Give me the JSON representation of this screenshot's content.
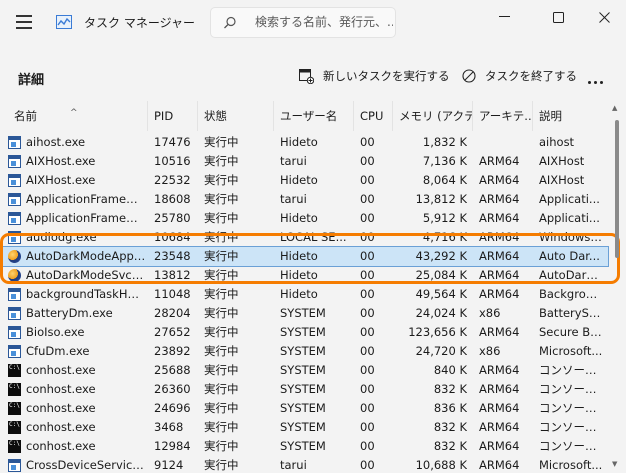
{
  "titlebar": {
    "title": "タスク マネージャー",
    "search_placeholder": "検索する名前、発行元、..."
  },
  "commandbar": {
    "page_title": "詳細",
    "new_task_label": "新しいタスクを実行する",
    "end_task_label": "タスクを終了する"
  },
  "columns": {
    "name": "名前",
    "pid": "PID",
    "status": "状態",
    "user": "ユーザー名",
    "cpu": "CPU",
    "memory": "メモリ (アクティ...",
    "arch": "アーキテ...",
    "desc": "説明"
  },
  "rows": [
    {
      "icon": "win",
      "name": "aihost.exe",
      "pid": "17476",
      "status": "実行中",
      "user": "Hideto",
      "cpu": "00",
      "memory": "1,832 K",
      "arch": "",
      "desc": "aihost"
    },
    {
      "icon": "win",
      "name": "AIXHost.exe",
      "pid": "10516",
      "status": "実行中",
      "user": "tarui",
      "cpu": "00",
      "memory": "7,136 K",
      "arch": "ARM64",
      "desc": "AIXHost"
    },
    {
      "icon": "win",
      "name": "AIXHost.exe",
      "pid": "22532",
      "status": "実行中",
      "user": "Hideto",
      "cpu": "00",
      "memory": "8,064 K",
      "arch": "ARM64",
      "desc": "AIXHost"
    },
    {
      "icon": "win",
      "name": "ApplicationFrameHo...",
      "pid": "18608",
      "status": "実行中",
      "user": "tarui",
      "cpu": "00",
      "memory": "13,812 K",
      "arch": "ARM64",
      "desc": "Applicati..."
    },
    {
      "icon": "win",
      "name": "ApplicationFrameHo...",
      "pid": "25780",
      "status": "実行中",
      "user": "Hideto",
      "cpu": "00",
      "memory": "5,912 K",
      "arch": "ARM64",
      "desc": "Applicati..."
    },
    {
      "icon": "win",
      "name": "audiodg.exe",
      "pid": "10684",
      "status": "実行中",
      "user": "LOCAL SE...",
      "cpu": "00",
      "memory": "4,716 K",
      "arch": "ARM64",
      "desc": "Windows ..."
    },
    {
      "icon": "auto",
      "name": "AutoDarkModeApp....",
      "pid": "23548",
      "status": "実行中",
      "user": "Hideto",
      "cpu": "00",
      "memory": "43,292 K",
      "arch": "ARM64",
      "desc": "Auto Dar..."
    },
    {
      "icon": "auto",
      "name": "AutoDarkModeSvc.e...",
      "pid": "13812",
      "status": "実行中",
      "user": "Hideto",
      "cpu": "00",
      "memory": "25,084 K",
      "arch": "ARM64",
      "desc": "AutoDark..."
    },
    {
      "icon": "win",
      "name": "backgroundTaskHos...",
      "pid": "11048",
      "status": "実行中",
      "user": "Hideto",
      "cpu": "00",
      "memory": "49,564 K",
      "arch": "ARM64",
      "desc": "Backgrou..."
    },
    {
      "icon": "win",
      "name": "BatteryDm.exe",
      "pid": "28204",
      "status": "実行中",
      "user": "SYSTEM",
      "cpu": "00",
      "memory": "24,024 K",
      "arch": "x86",
      "desc": "BatterySe..."
    },
    {
      "icon": "win",
      "name": "BioIso.exe",
      "pid": "27652",
      "status": "実行中",
      "user": "SYSTEM",
      "cpu": "00",
      "memory": "123,656 K",
      "arch": "ARM64",
      "desc": "Secure Bi..."
    },
    {
      "icon": "win",
      "name": "CfuDm.exe",
      "pid": "23892",
      "status": "実行中",
      "user": "SYSTEM",
      "cpu": "00",
      "memory": "24,720 K",
      "arch": "x86",
      "desc": "Microsoft..."
    },
    {
      "icon": "con",
      "name": "conhost.exe",
      "pid": "25688",
      "status": "実行中",
      "user": "SYSTEM",
      "cpu": "00",
      "memory": "840 K",
      "arch": "ARM64",
      "desc": "コンソール ..."
    },
    {
      "icon": "con",
      "name": "conhost.exe",
      "pid": "26360",
      "status": "実行中",
      "user": "SYSTEM",
      "cpu": "00",
      "memory": "832 K",
      "arch": "ARM64",
      "desc": "コンソール ..."
    },
    {
      "icon": "con",
      "name": "conhost.exe",
      "pid": "24696",
      "status": "実行中",
      "user": "SYSTEM",
      "cpu": "00",
      "memory": "836 K",
      "arch": "ARM64",
      "desc": "コンソール ..."
    },
    {
      "icon": "con",
      "name": "conhost.exe",
      "pid": "3468",
      "status": "実行中",
      "user": "SYSTEM",
      "cpu": "00",
      "memory": "832 K",
      "arch": "ARM64",
      "desc": "コンソール ..."
    },
    {
      "icon": "con",
      "name": "conhost.exe",
      "pid": "12984",
      "status": "実行中",
      "user": "SYSTEM",
      "cpu": "00",
      "memory": "832 K",
      "arch": "ARM64",
      "desc": "コンソール ..."
    },
    {
      "icon": "win",
      "name": "CrossDeviceService.e...",
      "pid": "9124",
      "status": "実行中",
      "user": "tarui",
      "cpu": "00",
      "memory": "10,688 K",
      "arch": "ARM64",
      "desc": "Microsoft..."
    }
  ],
  "selected_row": 6,
  "colors": {
    "highlight": "#f57c00",
    "selection": "#cce4f7"
  }
}
